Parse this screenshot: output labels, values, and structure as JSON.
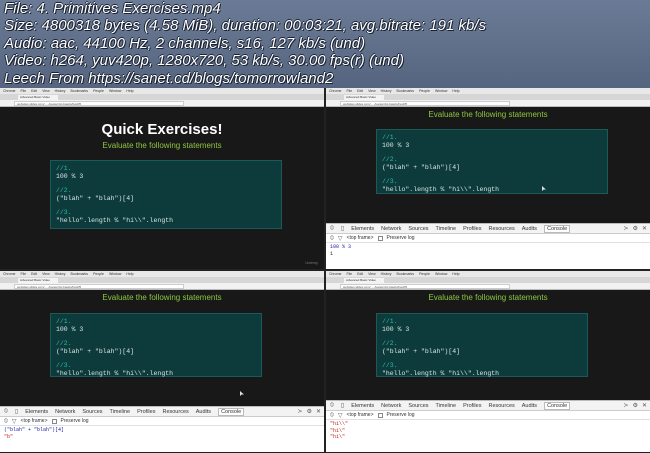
{
  "info": {
    "line1": "File: 4. Primitives Exercises.mp4",
    "line2": "Size: 4800318 bytes (4.58 MiB), duration: 00:03:21, avg.bitrate: 191 kb/s",
    "line3": "Audio: aac, 44100 Hz, 2 channels, s16, 127 kb/s (und)",
    "line4": "Video: h264, yuv420p, 1280x720, 53 kb/s, 30.00 fps(r) (und)",
    "line5": "Leech From https://sanet.cd/blogs/tomorrowland2"
  },
  "browser": {
    "menu": [
      "Chrome",
      "File",
      "Edit",
      "View",
      "History",
      "Bookmarks",
      "People",
      "Window",
      "Help"
    ],
    "tab_label": "Advanced Basic Video",
    "url": "websites.slides.com/...../javascript-basics/live#/5"
  },
  "slide": {
    "title": "Quick Exercises!",
    "subtitle": "Evaluate the following statements",
    "code": [
      {
        "comment": "//1.",
        "line": "100 % 3"
      },
      {
        "comment": "//2.",
        "line": "(\"blah\" + \"blah\")[4]"
      },
      {
        "comment": "//3.",
        "line": "\"hello\".length % \"hi\\\\\".length"
      }
    ],
    "logo": "Udemy"
  },
  "devtools": {
    "tabs": [
      "Elements",
      "Network",
      "Sources",
      "Timeline",
      "Profiles",
      "Resources",
      "Audits",
      "Console"
    ],
    "frame_select": "<top frame>",
    "preserve_log": "Preserve log"
  },
  "console2": {
    "input": "100 % 3",
    "output": "1"
  },
  "console3": {
    "input": "(\"blah\" + \"blah\")[4]",
    "output": "\"b\""
  },
  "console4": {
    "outputs": [
      "\"hi\\\\\"",
      "\"hi\\\"",
      "\"hi\\\""
    ]
  }
}
